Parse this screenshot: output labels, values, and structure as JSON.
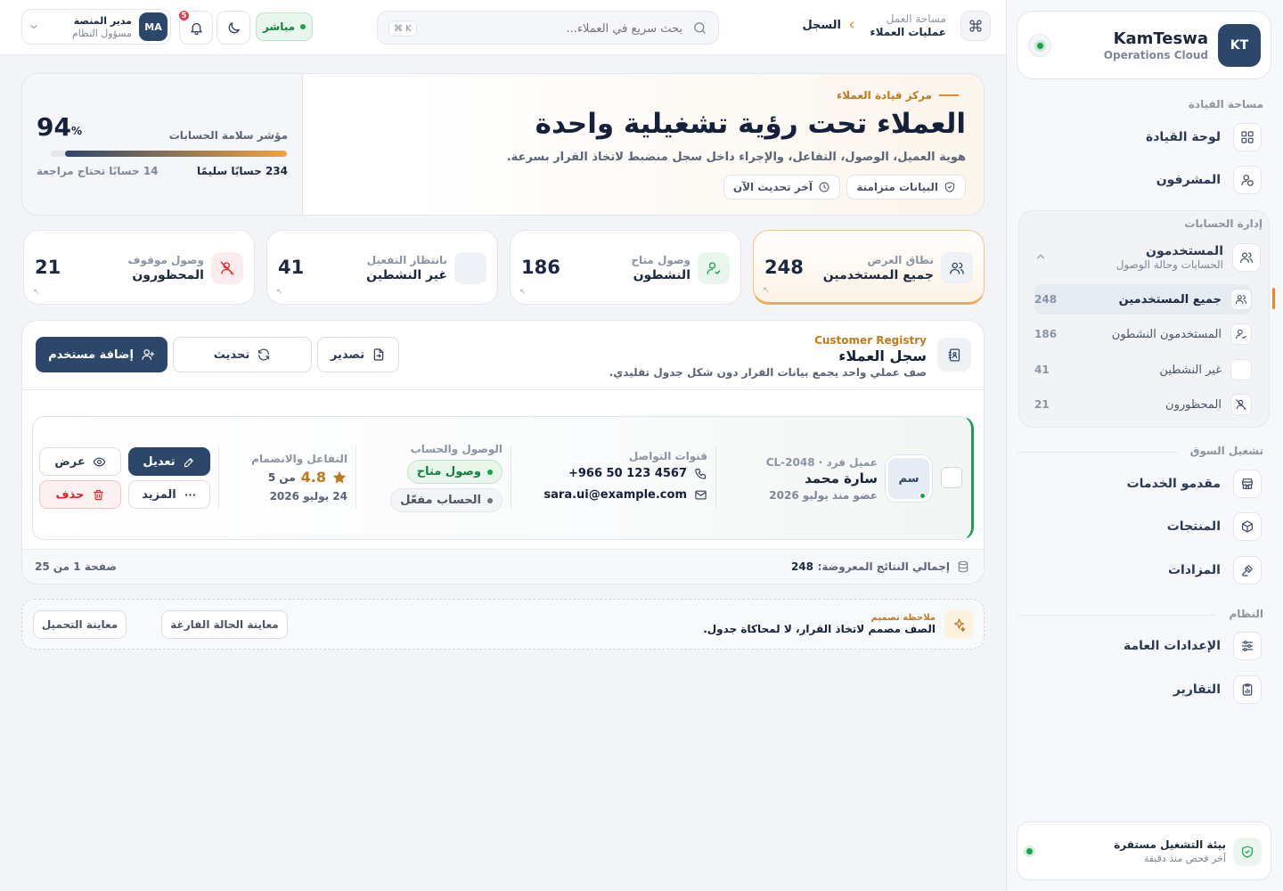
{
  "brand": {
    "initials": "KT",
    "name": "KamTeswa",
    "tagline": "Operations Cloud"
  },
  "sidebar": {
    "sections": [
      {
        "title": "مساحة القيادة",
        "items": [
          {
            "label": "لوحة القيادة",
            "icon": "grid-icon"
          },
          {
            "label": "المشرفون",
            "icon": "user-shield-icon"
          }
        ]
      },
      {
        "title": "إدارة الحسابات"
      },
      {
        "title": "تشغيل السوق",
        "items": [
          {
            "label": "مقدمو الخدمات",
            "icon": "store-icon"
          },
          {
            "label": "المنتجات",
            "icon": "box-icon"
          },
          {
            "label": "المزادات",
            "icon": "gavel-icon"
          }
        ]
      },
      {
        "title": "النظام",
        "items": [
          {
            "label": "الإعدادات العامة",
            "icon": "sliders-icon"
          },
          {
            "label": "التقارير",
            "icon": "report-icon"
          }
        ]
      }
    ],
    "users_group": {
      "title": "المستخدمون",
      "subtitle": "الحسابات وحالة الوصول",
      "items": [
        {
          "label": "جميع المستخدمين",
          "count": "248"
        },
        {
          "label": "المستخدمون النشطون",
          "count": "186"
        },
        {
          "label": "غير النشطين",
          "count": "41"
        },
        {
          "label": "المحظورون",
          "count": "21"
        }
      ]
    },
    "footer": {
      "title": "بيئة التشغيل مستقرة",
      "subtitle": "آخر فحص منذ دقيقة"
    }
  },
  "header": {
    "breadcrumb_root": "مساحة العمل",
    "breadcrumb_sub": "عمليات العملاء",
    "breadcrumb_current": "السجل",
    "search_placeholder": "بحث سريع في العملاء...",
    "search_shortcut": "⌘ K",
    "live_label": "مباشر",
    "notif_count": "5",
    "user_initials": "MA",
    "user_name": "مدير المنصة",
    "user_role": "مسؤول النظام"
  },
  "hero": {
    "eyebrow": "مركز قيادة العملاء",
    "title": "العملاء تحت رؤية تشغيلية واحدة",
    "subtitle": "هوية العميل، الوصول، التفاعل، والإجراء داخل سجل منضبط لاتخاذ القرار بسرعة.",
    "sync_label": "البيانات متزامنة",
    "updated_label": "آخر تحديث الآن",
    "health_label": "مؤشر سلامة الحسابات",
    "health_value": "94",
    "health_unit": "%",
    "health_progress": 0.94,
    "healthy_count": "234 حسابًا سليمًا",
    "review_count": "14 حسابًا تحتاج مراجعة"
  },
  "stats": [
    {
      "caption": "نطاق العرض",
      "label": "جميع المستخدمين",
      "value": "248",
      "icon": "users-icon"
    },
    {
      "caption": "وصول متاح",
      "label": "النشطون",
      "value": "186",
      "icon": "user-check-icon"
    },
    {
      "caption": "بانتظار التفعيل",
      "label": "غير النشطين",
      "value": "41",
      "icon": "blank-icon"
    },
    {
      "caption": "وصول موقوف",
      "label": "المحظورون",
      "value": "21",
      "icon": "user-ban-icon"
    }
  ],
  "registry": {
    "eyebrow": "Customer Registry",
    "title": "سجل العملاء",
    "subtitle": "صف عملي واحد يجمع بيانات القرار دون شكل جدول تقليدي.",
    "export_label": "تصدير",
    "refresh_label": "تحديث",
    "add_label": "إضافة مستخدم",
    "row": {
      "avatar": "سم",
      "meta": "عميل فرد · CL-2048",
      "name": "سارة محمد",
      "since": "عضو منذ يوليو 2026",
      "contact_caption": "قنوات التواصل",
      "phone": "+966 50 123 4567",
      "email": "sara.ui@example.com",
      "access_caption": "الوصول والحساب",
      "access_badge": "وصول متاح",
      "account_badge": "الحساب مفعّل",
      "engagement_caption": "التفاعل والانضمام",
      "rating": "4.8",
      "rating_of": "من 5",
      "joined": "24 يوليو 2026",
      "view_label": "عرض",
      "edit_label": "تعديل",
      "more_label": "المزيد",
      "delete_label": "حذف"
    },
    "total_label": "إجمالي النتائج المعروضة:",
    "total_value": "248",
    "page_label": "صفحة 1 من 25"
  },
  "note": {
    "eyebrow": "ملاحظة تصميم",
    "text": "الصف مصمم لاتخاذ القرار، لا لمحاكاة جدول.",
    "empty_label": "معاينة الحالة الفارغة",
    "loading_label": "معاينة التحميل"
  },
  "colors": {
    "navy": "#2d476b",
    "accent": "#c07a1a",
    "green": "#16a34a",
    "red": "#dc2626"
  }
}
